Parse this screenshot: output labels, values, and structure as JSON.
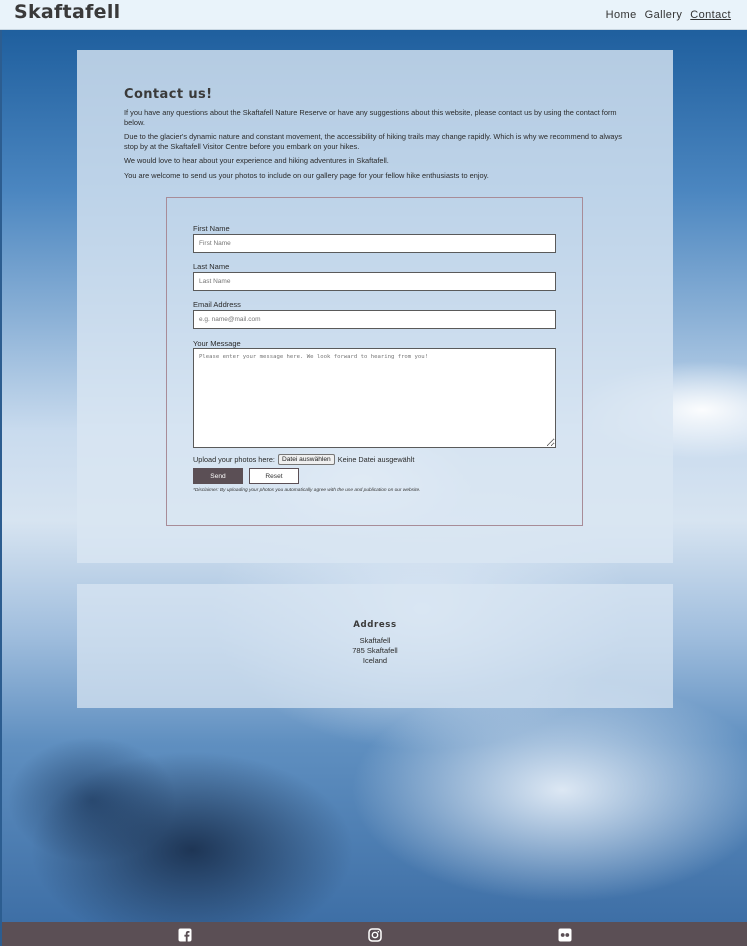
{
  "header": {
    "brand": "Skaftafell",
    "nav": [
      {
        "label": "Home"
      },
      {
        "label": "Gallery"
      },
      {
        "label": "Contact",
        "active": true
      }
    ]
  },
  "contact": {
    "title": "Contact us!",
    "paragraphs": [
      "If you have any questions about the Skaftafell Nature Reserve or have any suggestions about this website, please contact us by using the contact form below.",
      "Due to the glacier's dynamic nature and constant movement, the accessibility of hiking trails may change rapidly. Which is why we recommend to always stop by at the Skaftafell Visitor Centre before you embark on your hikes.",
      "We would love to hear about your experience and hiking adventures in Skaftafell.",
      "You are welcome to send us your photos to include on our gallery page for your fellow hike enthusiasts to enjoy."
    ]
  },
  "form": {
    "first_name": {
      "label": "First Name",
      "placeholder": "First Name"
    },
    "last_name": {
      "label": "Last Name",
      "placeholder": "Last Name"
    },
    "email": {
      "label": "Email Address",
      "placeholder": "e.g. name@mail.com"
    },
    "message": {
      "label": "Your Message",
      "placeholder": "Please enter your message here. We look forward to hearing from you!"
    },
    "upload": {
      "label": "Upload your photos here:",
      "button": "Datei auswählen",
      "status": "Keine Datei ausgewählt"
    },
    "send_label": "Send",
    "reset_label": "Reset",
    "disclaimer": "*Disclaimer: By uploading your photos you automatically agree with the use and publication on our website."
  },
  "address": {
    "title": "Address",
    "lines": [
      "Skaftafell",
      "785 Skaftafell",
      "Iceland"
    ]
  },
  "footer": {
    "icons": [
      "facebook-icon",
      "instagram-icon",
      "flickr-icon"
    ]
  },
  "colors": {
    "footer_bg": "#5b4f55",
    "header_bg": "#e9f3fa",
    "send_button": "#5b4f55",
    "form_border": "#a88c98"
  }
}
